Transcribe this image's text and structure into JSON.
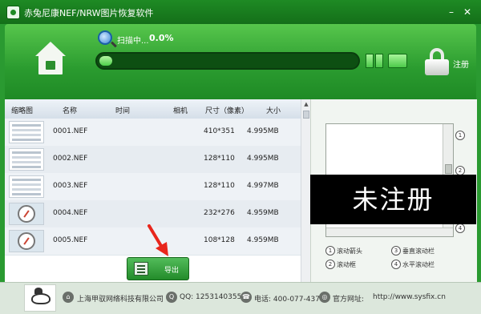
{
  "window": {
    "title": "赤兔尼康NEF/NRW图片恢复软件",
    "minimize": "–",
    "close": "✕"
  },
  "toolbar": {
    "scan_label": "扫描中...",
    "scan_percent": "0.0%",
    "progress_fraction": 0.05,
    "register_label": "注册",
    "icons": [
      "home-icon",
      "search-icon",
      "lock-icon"
    ]
  },
  "table": {
    "columns": [
      "缩略图",
      "名称",
      "时间",
      "相机",
      "尺寸（像素）",
      "大小"
    ],
    "rows": [
      {
        "thumb": "doc",
        "name": "0001.NEF",
        "time": "",
        "camera": "",
        "size": "410*351",
        "filesize": "4.995MB"
      },
      {
        "thumb": "doc",
        "name": "0002.NEF",
        "time": "",
        "camera": "",
        "size": "128*110",
        "filesize": "4.995MB"
      },
      {
        "thumb": "doc",
        "name": "0003.NEF",
        "time": "",
        "camera": "",
        "size": "128*110",
        "filesize": "4.997MB"
      },
      {
        "thumb": "gauge",
        "name": "0004.NEF",
        "time": "",
        "camera": "",
        "size": "232*276",
        "filesize": "4.959MB"
      },
      {
        "thumb": "gauge",
        "name": "0005.NEF",
        "time": "",
        "camera": "",
        "size": "108*128",
        "filesize": "4.959MB"
      }
    ]
  },
  "export_button": {
    "label": "导出"
  },
  "preview": {
    "watermark": "未注册",
    "callouts": [
      "1",
      "2",
      "4"
    ],
    "legend": [
      {
        "num": "1",
        "text": "滚动箭头"
      },
      {
        "num": "3",
        "text": "垂直滚动栏"
      },
      {
        "num": "2",
        "text": "滚动框"
      },
      {
        "num": "4",
        "text": "水平滚动栏"
      }
    ]
  },
  "footer": {
    "company": "上海甲驭网络科技有限公司",
    "qq": "QQ: 1253140355",
    "phone": "电话: 400-077-4377",
    "website_label": "官方网址:",
    "website": "http://www.sysfix.cn"
  }
}
